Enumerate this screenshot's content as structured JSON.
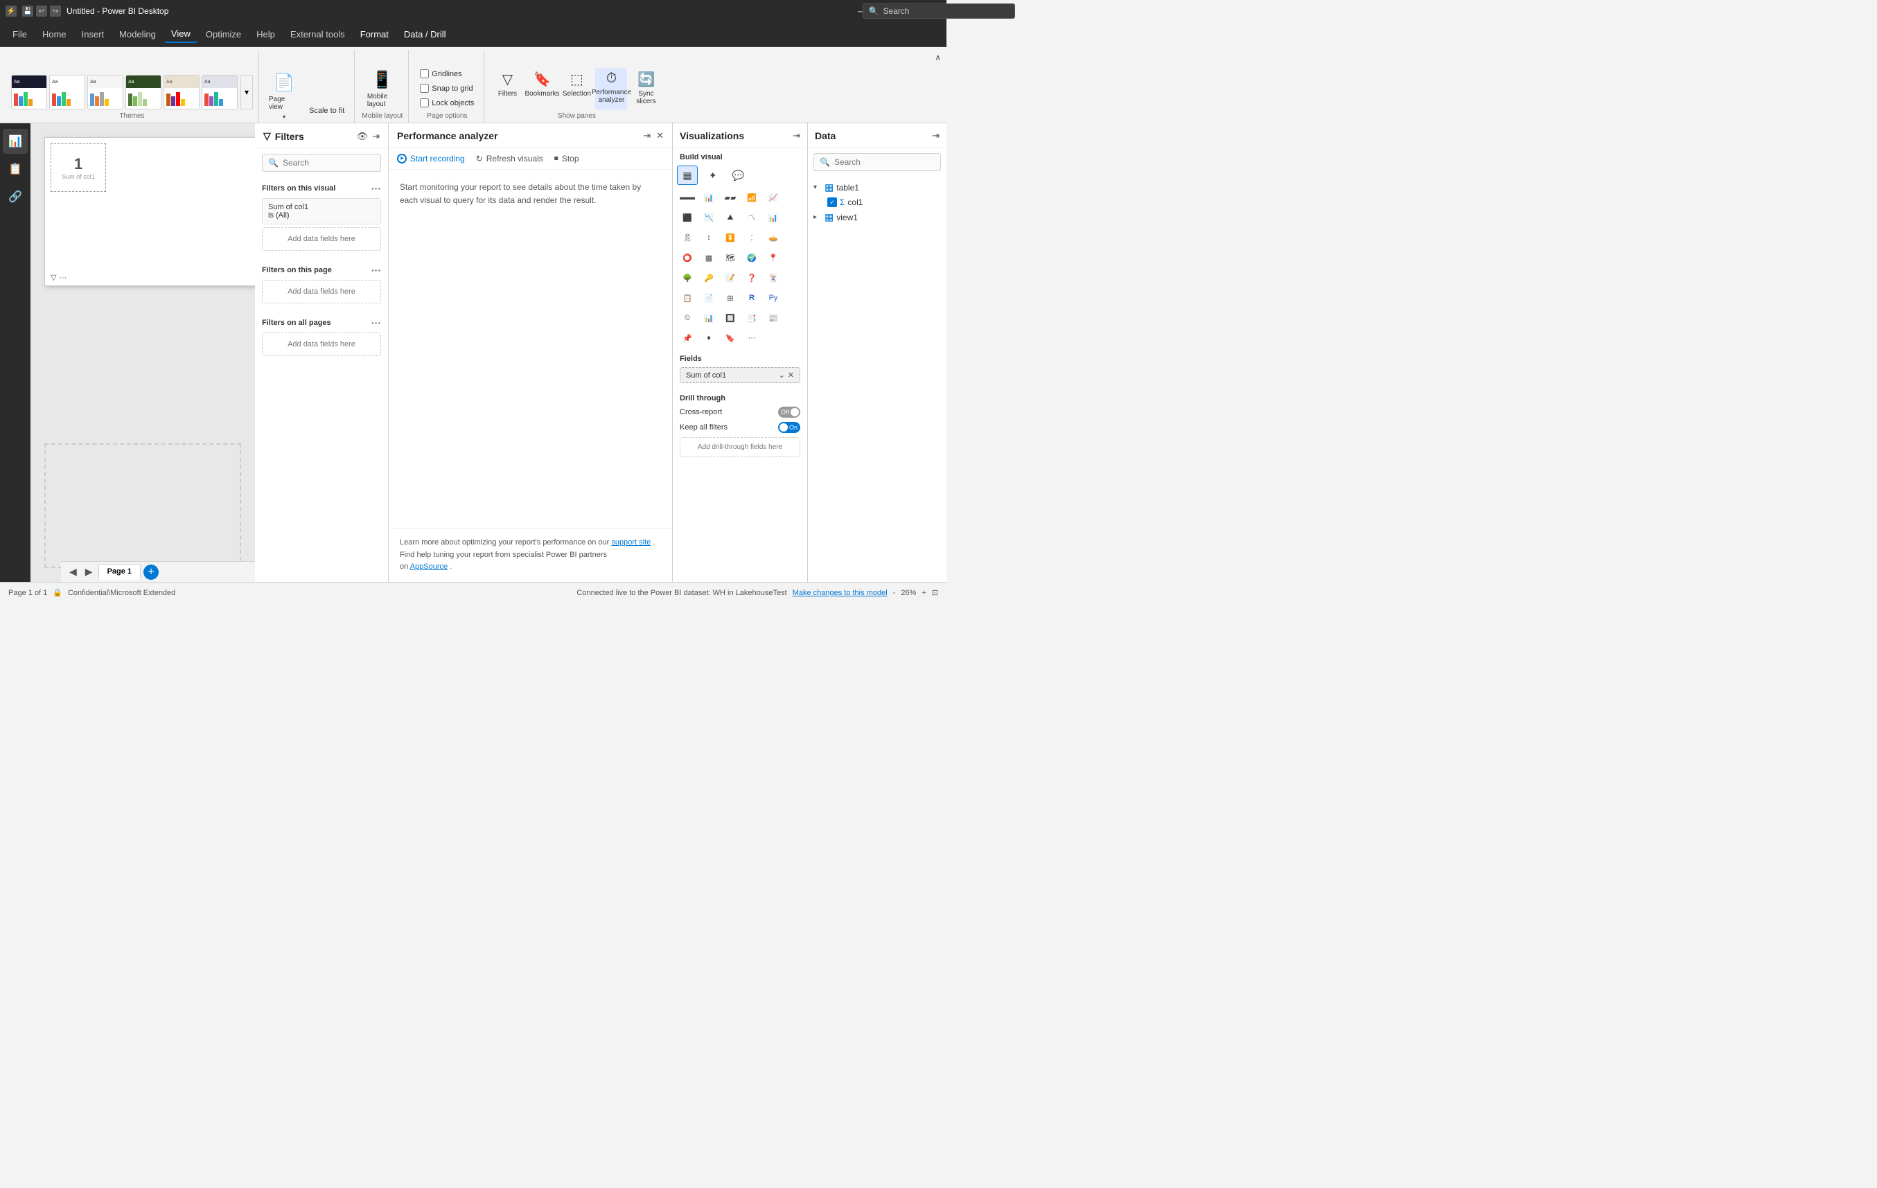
{
  "titlebar": {
    "title": "Untitled - Power BI Desktop",
    "search_placeholder": "Search",
    "min_label": "─",
    "max_label": "□",
    "close_label": "✕"
  },
  "menubar": {
    "items": [
      {
        "label": "File",
        "active": false
      },
      {
        "label": "Home",
        "active": false
      },
      {
        "label": "Insert",
        "active": false
      },
      {
        "label": "Modeling",
        "active": false
      },
      {
        "label": "View",
        "active": true
      },
      {
        "label": "Optimize",
        "active": false
      },
      {
        "label": "Help",
        "active": false
      },
      {
        "label": "External tools",
        "active": false
      },
      {
        "label": "Format",
        "active": false
      },
      {
        "label": "Data / Drill",
        "active": false
      }
    ]
  },
  "ribbon": {
    "themes_label": "Themes",
    "page_view_label": "Scale to fit",
    "mobile_label": "Mobile layout",
    "page_options_label": "Page options",
    "show_panes_label": "Show panes",
    "gridlines": "Gridlines",
    "snap_to_grid": "Snap to grid",
    "lock_objects": "Lock objects",
    "page_view_btn": "Page view",
    "mobile_btn": "Mobile layout",
    "filters_btn": "Filters",
    "bookmarks_btn": "Bookmarks",
    "selection_btn": "Selection",
    "performance_btn": "Performance analyzer",
    "sync_slicers_btn": "Sync slicers"
  },
  "filters_panel": {
    "title": "Filters",
    "search_placeholder": "Search",
    "filters_on_visual": "Filters on this visual",
    "filter_card_line1": "Sum of col1",
    "filter_card_line2": "is (All)",
    "add_data_visual": "Add data fields here",
    "filters_on_page": "Filters on this page",
    "add_data_page": "Add data fields here",
    "filters_on_all": "Filters on all pages",
    "add_data_all": "Add data fields here"
  },
  "perf_panel": {
    "title": "Performance analyzer",
    "start_recording": "Start recording",
    "refresh_visuals": "Refresh visuals",
    "stop": "Stop",
    "content": "Start monitoring your report to see details about the time taken by each visual to query for its data and render the result.",
    "footer_line1": "Learn more about optimizing your report's performance on our",
    "footer_link1": "support site",
    "footer_line2": "Find help tuning your report from specialist Power BI partners",
    "footer_line3": "on",
    "footer_link2": "AppSource",
    "footer_period": "."
  },
  "viz_panel": {
    "title": "Visualizations",
    "build_visual": "Build visual",
    "fields_label": "Fields",
    "field_chip": "Sum of col1",
    "drill_title": "Drill through",
    "cross_report": "Cross-report",
    "keep_all_filters": "Keep all filters",
    "toggle_cross_off": "Off",
    "toggle_keep_on": "On",
    "add_drill": "Add drill-through fields here"
  },
  "data_panel": {
    "title": "Data",
    "search_placeholder": "Search",
    "table1": "table1",
    "col1": "col1",
    "view1": "view1"
  },
  "status_bar": {
    "page_info": "Page 1 of 1",
    "confidential": "Confidential\\Microsoft Extended",
    "connected": "Connected live to the Power BI dataset: WH in LakehouseTest",
    "make_changes": "Make changes to this model",
    "zoom": "26%"
  },
  "page_tabs": {
    "page1": "Page 1"
  },
  "colors": {
    "accent": "#0078d4",
    "toggle_on": "#0078d4",
    "toggle_off": "#999999"
  }
}
